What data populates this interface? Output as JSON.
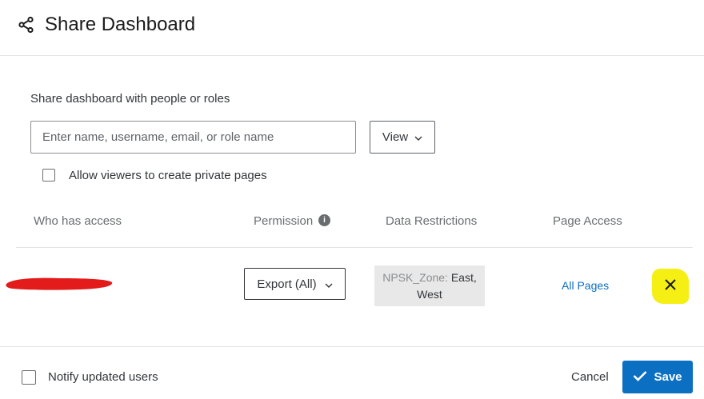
{
  "header": {
    "title": "Share Dashboard",
    "icon": "share-icon"
  },
  "share": {
    "section_label": "Share dashboard with people or roles",
    "search_placeholder": "Enter name, username, email, or role name",
    "view_label": "View",
    "allow_private_label": "Allow viewers to create private pages",
    "allow_private_checked": false
  },
  "table": {
    "headers": {
      "who": "Who has access",
      "permission": "Permission",
      "restrictions": "Data Restrictions",
      "page_access": "Page Access"
    },
    "rows": [
      {
        "name_redacted": true,
        "permission": "Export (All)",
        "restriction_key": "NPSK_Zone:",
        "restriction_values_line1": "East,",
        "restriction_values_line2": "West",
        "page_access": "All Pages"
      }
    ]
  },
  "footer": {
    "notify_label": "Notify updated users",
    "notify_checked": false,
    "cancel_label": "Cancel",
    "save_label": "Save"
  },
  "colors": {
    "primary": "#0b6fc2",
    "highlight": "#f5ef14",
    "redaction": "#e31b1b"
  }
}
